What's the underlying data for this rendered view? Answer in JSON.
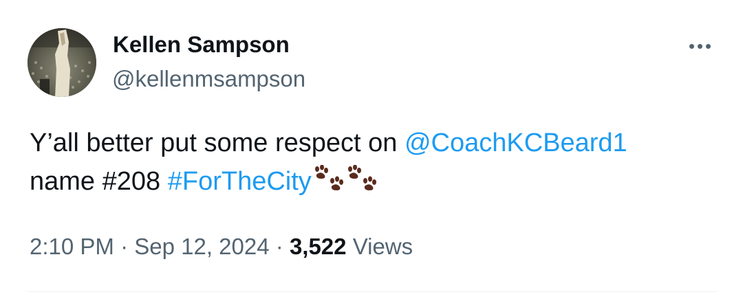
{
  "author": {
    "display_name": "Kellen Sampson",
    "handle": "@kellenmsampson"
  },
  "tweet": {
    "text_before_mention": "Y’all better put some respect on ",
    "mention": "@CoachKCBeard1",
    "text_after_mention": " name #208 ",
    "hashtag": "#ForTheCity",
    "emoji": [
      "paw-prints-icon",
      "paw-prints-icon"
    ]
  },
  "meta": {
    "time": "2:10 PM",
    "separator": "·",
    "date": "Sep 12, 2024",
    "views_count": "3,522",
    "views_label": "Views"
  },
  "colors": {
    "link": "#1d9bf0",
    "secondary_text": "#536471",
    "primary_text": "#0f1419",
    "paw": "#5a2b1d"
  }
}
